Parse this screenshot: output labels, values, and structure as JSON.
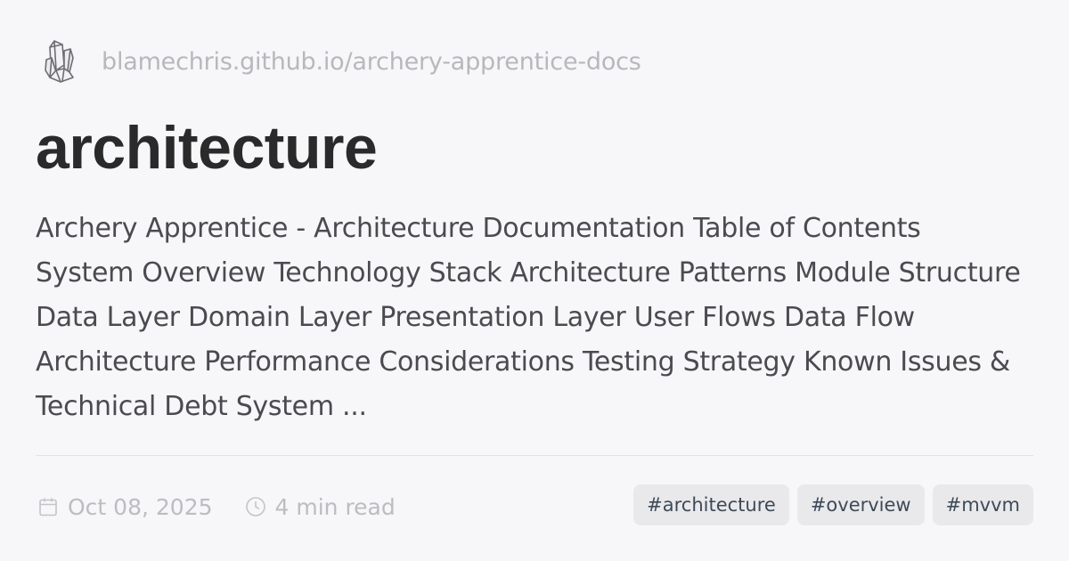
{
  "header": {
    "logo_icon": "crystal-cluster-icon",
    "site_url": "blamechris.github.io/archery-apprentice-docs"
  },
  "post": {
    "title": "architecture",
    "excerpt": "Archery Apprentice - Architecture Documentation Table of Contents System Overview Technology Stack Architecture Patterns Module Structure Data Layer Domain Layer Presentation Layer User Flows Data Flow Architecture Performance Considerations Testing Strategy Known Issues & Technical Debt System ...",
    "date": "Oct 08, 2025",
    "date_icon": "calendar-icon",
    "read_time": "4 min read",
    "read_time_icon": "clock-icon",
    "tags": [
      "#architecture",
      "#overview",
      "#mvvm"
    ]
  },
  "colors": {
    "background": "#f7f6f8",
    "title": "#2a2a2a",
    "body_text": "#4b4b4f",
    "muted": "#bdbdc1",
    "tag_bg": "#e9e9ec",
    "tag_text": "#3e4a58"
  }
}
